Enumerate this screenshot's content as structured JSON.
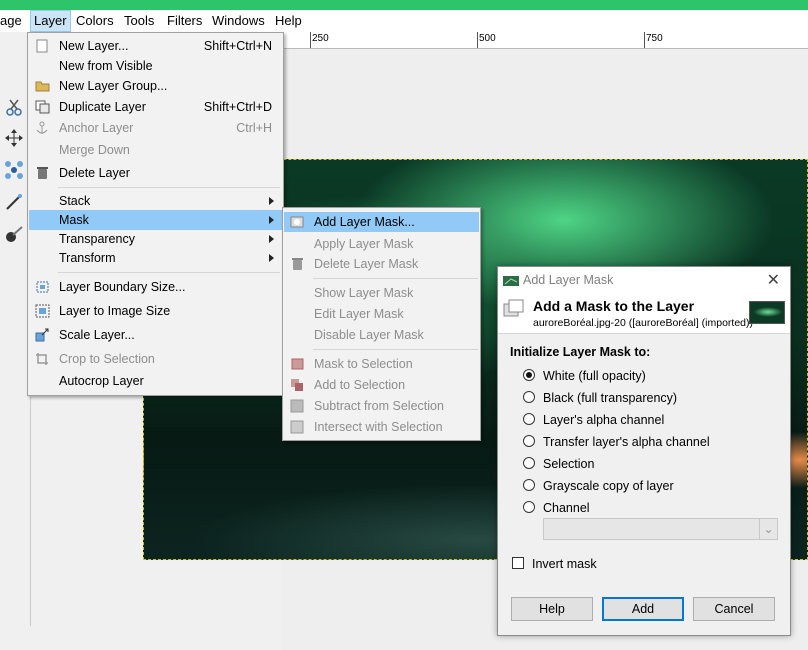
{
  "menubar": {
    "items": [
      "age",
      "Layer",
      "Colors",
      "Tools",
      "Filters",
      "Windows",
      "Help"
    ]
  },
  "ruler": {
    "labels": [
      "250",
      "500",
      "750"
    ]
  },
  "layer_menu": {
    "items": [
      {
        "label": "New Layer...",
        "shortcut": "Shift+Ctrl+N",
        "icon": "new-layer-icon"
      },
      {
        "label": "New from Visible",
        "icon": ""
      },
      {
        "label": "New Layer Group...",
        "icon": "folder-icon"
      },
      {
        "label": "Duplicate Layer",
        "shortcut": "Shift+Ctrl+D",
        "icon": "duplicate-icon"
      },
      {
        "label": "Anchor Layer",
        "shortcut": "Ctrl+H",
        "icon": "anchor-icon",
        "disabled": true
      },
      {
        "label": "Merge Down",
        "icon": "",
        "disabled": true
      },
      {
        "label": "Delete Layer",
        "icon": "trash-icon"
      },
      {
        "label": "Stack",
        "submenu": true
      },
      {
        "label": "Mask",
        "submenu": true,
        "highlighted": true
      },
      {
        "label": "Transparency",
        "submenu": true
      },
      {
        "label": "Transform",
        "submenu": true
      },
      {
        "label": "Layer Boundary Size...",
        "icon": "boundary-icon"
      },
      {
        "label": "Layer to Image Size",
        "icon": "image-size-icon"
      },
      {
        "label": "Scale Layer...",
        "icon": "scale-icon"
      },
      {
        "label": "Crop to Selection",
        "icon": "crop-icon",
        "disabled": true
      },
      {
        "label": "Autocrop Layer",
        "icon": ""
      }
    ]
  },
  "mask_menu": {
    "items": [
      {
        "label": "Add Layer Mask...",
        "highlighted": true
      },
      {
        "label": "Apply Layer Mask",
        "disabled": true
      },
      {
        "label": "Delete Layer Mask",
        "disabled": true
      },
      {
        "label": "Show Layer Mask",
        "disabled": true
      },
      {
        "label": "Edit Layer Mask",
        "disabled": true
      },
      {
        "label": "Disable Layer Mask",
        "disabled": true
      },
      {
        "label": "Mask to Selection",
        "disabled": true
      },
      {
        "label": "Add to Selection",
        "disabled": true
      },
      {
        "label": "Subtract from Selection",
        "disabled": true
      },
      {
        "label": "Intersect with Selection",
        "disabled": true
      }
    ]
  },
  "dialog": {
    "window_title": "Add Layer Mask",
    "header_title": "Add a Mask to the Layer",
    "header_subtitle": "auroreBoréal.jpg-20 ([auroreBoréal] (imported))",
    "section_label": "Initialize Layer Mask to:",
    "options": [
      "White (full opacity)",
      "Black (full transparency)",
      "Layer's alpha channel",
      "Transfer layer's alpha channel",
      "Selection",
      "Grayscale copy of layer",
      "Channel"
    ],
    "selected_option": "White (full opacity)",
    "invert_label": "Invert mask",
    "invert_checked": false,
    "buttons": {
      "help": "Help",
      "add": "Add",
      "cancel": "Cancel"
    }
  },
  "colors": {
    "highlight": "#91c9f7",
    "titlebar": "#2ec46a",
    "default_button_border": "#0078d7"
  }
}
